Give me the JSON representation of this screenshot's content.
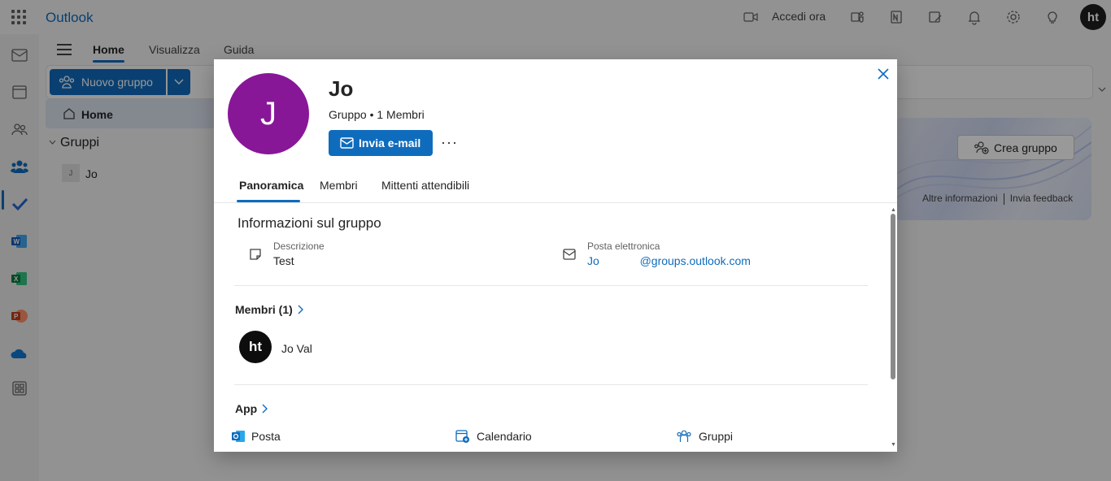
{
  "app": {
    "name": "Outlook"
  },
  "topbar": {
    "meet_label": "Accedi ora",
    "avatar_initials": "ht"
  },
  "ribbon": {
    "tabs": [
      {
        "label": "Home",
        "active": true
      },
      {
        "label": "Visualizza",
        "active": false
      },
      {
        "label": "Guida",
        "active": false
      }
    ],
    "new_group_label": "Nuovo gruppo"
  },
  "leftnav": {
    "home_label": "Home",
    "groups_label": "Gruppi",
    "groups": [
      {
        "initial": "J",
        "label": "Jo"
      }
    ]
  },
  "banner": {
    "create_label": "Crea gruppo",
    "more_info": "Altre informazioni",
    "feedback": "Invia feedback"
  },
  "modal": {
    "avatar_initial": "J",
    "avatar_color": "#881798",
    "title": "Jo",
    "subtitle": "Gruppo • 1 Membri",
    "send_email_label": "Invia e-mail",
    "more_label": "···",
    "tabs": [
      {
        "label": "Panoramica",
        "active": true
      },
      {
        "label": "Membri",
        "active": false
      },
      {
        "label": "Mittenti attendibili",
        "active": false
      }
    ],
    "info_title": "Informazioni sul gruppo",
    "description_label": "Descrizione",
    "description_value": "Test",
    "email_label": "Posta elettronica",
    "email_user": "Jo",
    "email_domain": "@groups.outlook.com",
    "members_heading": "Membri (1)",
    "members": [
      {
        "initials": "ht",
        "name": "Jo Val"
      }
    ],
    "apps_heading": "App",
    "apps": [
      {
        "label": "Posta",
        "icon": "outlook-icon"
      },
      {
        "label": "Calendario",
        "icon": "calendar-icon"
      },
      {
        "label": "Gruppi",
        "icon": "groups-icon"
      }
    ]
  },
  "colors": {
    "accent": "#0f6cbd",
    "group_avatar": "#881798"
  }
}
